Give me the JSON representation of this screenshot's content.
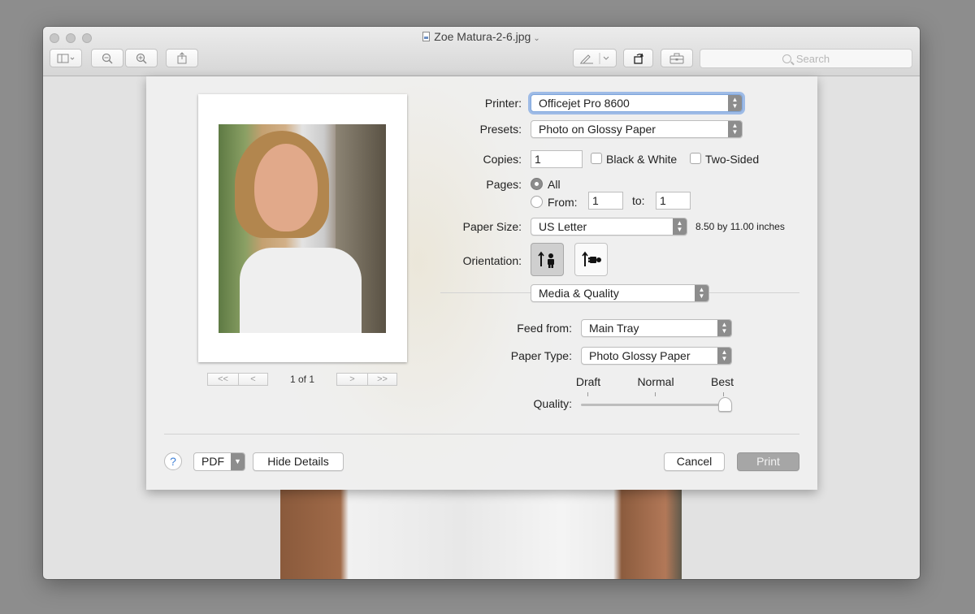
{
  "window": {
    "title": "Zoe Matura-2-6.jpg"
  },
  "toolbar": {
    "sidebar_icon": "sidebar-icon",
    "zoom_out_icon": "zoom-out-icon",
    "zoom_in_icon": "zoom-in-icon",
    "share_icon": "share-icon",
    "markup_icon": "markup-pen-icon",
    "rotate_icon": "rotate-icon",
    "toolbox_icon": "toolbox-icon",
    "search_placeholder": "Search"
  },
  "preview": {
    "page_count": "1 of 1",
    "first": "<<",
    "prev": "<",
    "next": ">",
    "last": ">>"
  },
  "printer": {
    "label": "Printer:",
    "value": "Officejet Pro 8600"
  },
  "presets": {
    "label": "Presets:",
    "value": "Photo on Glossy Paper"
  },
  "copies": {
    "label": "Copies:",
    "value": "1",
    "black_white": "Black & White",
    "two_sided": "Two-Sided"
  },
  "pages": {
    "label": "Pages:",
    "all": "All",
    "from": "From:",
    "from_value": "1",
    "to": "to:",
    "to_value": "1"
  },
  "paper_size": {
    "label": "Paper Size:",
    "value": "US Letter",
    "dimensions": "8.50 by 11.00 inches"
  },
  "orientation": {
    "label": "Orientation:",
    "options": [
      "portrait-icon",
      "landscape-icon"
    ],
    "selected": "portrait"
  },
  "section": {
    "value": "Media & Quality"
  },
  "feed_from": {
    "label": "Feed from:",
    "value": "Main Tray"
  },
  "paper_type": {
    "label": "Paper Type:",
    "value": "Photo Glossy Paper"
  },
  "quality": {
    "label": "Quality:",
    "levels": [
      "Draft",
      "Normal",
      "Best"
    ],
    "selected": "Best"
  },
  "footer": {
    "help": "?",
    "pdf": "PDF",
    "hide_details": "Hide Details",
    "cancel": "Cancel",
    "print": "Print"
  },
  "colors": {
    "focus_ring": "#9ebbe6",
    "stepper": "#8d8d8d",
    "print_disabled": "#a6a6a6"
  }
}
